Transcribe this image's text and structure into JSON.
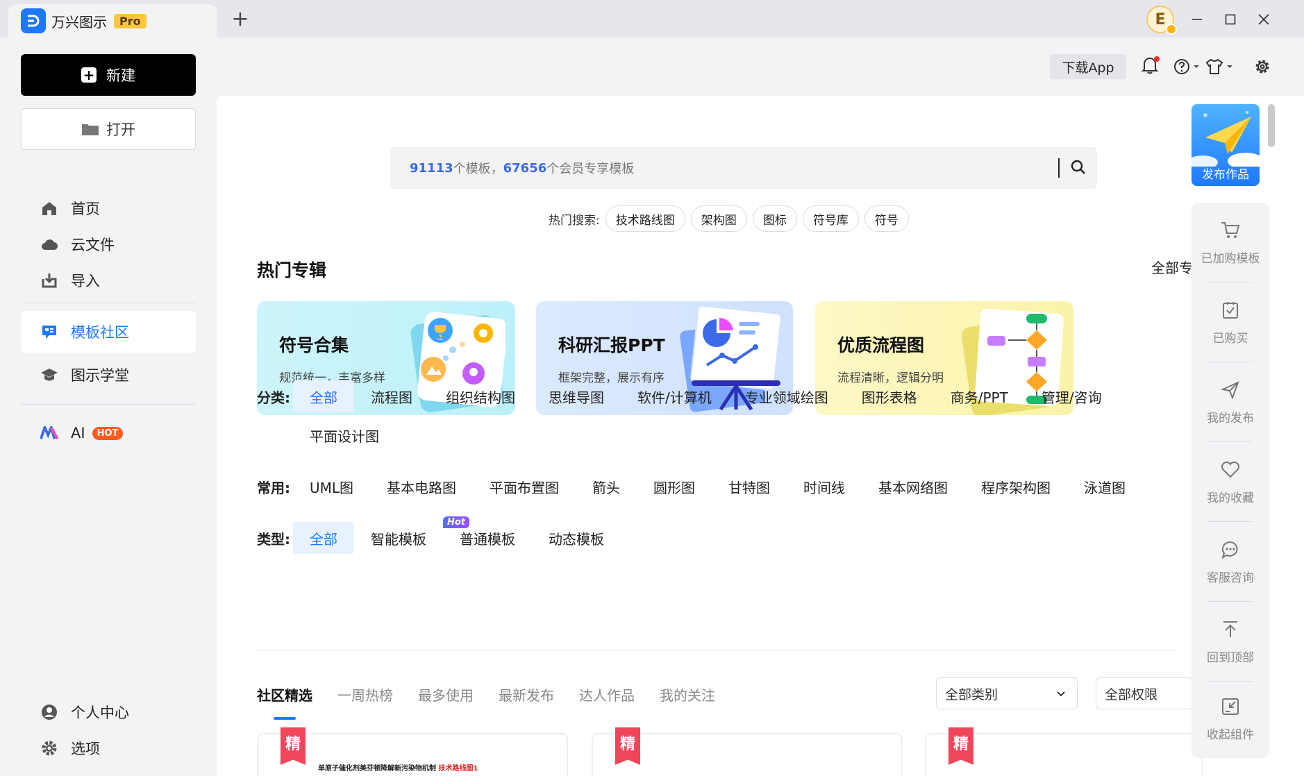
{
  "app": {
    "name": "万兴图示",
    "badge": "Pro",
    "avatar_letter": "E"
  },
  "sidebar": {
    "new_label": "新建",
    "open_label": "打开",
    "items": [
      {
        "label": "首页"
      },
      {
        "label": "云文件"
      },
      {
        "label": "导入"
      },
      {
        "label": "模板社区"
      },
      {
        "label": "图示学堂"
      },
      {
        "label": "AI",
        "badge": "HOT"
      },
      {
        "label": "个人中心"
      },
      {
        "label": "选项"
      }
    ]
  },
  "toolbar": {
    "download_label": "下载App"
  },
  "search": {
    "count_total": "91113",
    "text_mid": "个模板，",
    "count_member": "67656",
    "text_end": "个会员专享模板"
  },
  "hot_search": {
    "label": "热门搜索:",
    "chips": [
      "技术路线图",
      "架构图",
      "图标",
      "符号库",
      "符号"
    ]
  },
  "featured": {
    "title": "热门专辑",
    "all_label": "全部专",
    "cards": [
      {
        "title": "符号合集",
        "subtitle": "规范统一，丰富多样"
      },
      {
        "title": "科研汇报PPT",
        "subtitle": "框架完整，展示有序"
      },
      {
        "title": "优质流程图",
        "subtitle": "流程清晰，逻辑分明"
      }
    ]
  },
  "filters": {
    "category_label": "分类:",
    "categories": [
      "全部",
      "流程图",
      "组织结构图",
      "思维导图",
      "软件/计算机",
      "专业领域绘图",
      "图形表格",
      "商务/PPT",
      "管理/咨询",
      "平面设计图"
    ],
    "common_label": "常用:",
    "common": [
      "UML图",
      "基本电路图",
      "平面布置图",
      "箭头",
      "圆形图",
      "甘特图",
      "时间线",
      "基本网络图",
      "程序架构图",
      "泳道图"
    ],
    "type_label": "类型:",
    "types": [
      "全部",
      "智能模板",
      "普通模板",
      "动态模板"
    ],
    "type_hot": "Hot"
  },
  "tabs": [
    "社区精选",
    "一周热榜",
    "最多使用",
    "最新发布",
    "达人作品",
    "我的关注"
  ],
  "dropdowns": {
    "category": "全部类别",
    "permission": "全部权限"
  },
  "templates": [
    {
      "badge": "精",
      "line_a": "单原子催化剂美芬顿降解新污染物机制 ",
      "line_b": "技术路线图1"
    },
    {
      "badge": "精"
    },
    {
      "badge": "精"
    }
  ],
  "rail": {
    "publish_label": "发布作品",
    "items": [
      {
        "label": "已加购模板",
        "icon": "cart-icon"
      },
      {
        "label": "已购买",
        "icon": "purchased-icon"
      },
      {
        "label": "我的发布",
        "icon": "send-icon"
      },
      {
        "label": "我的收藏",
        "icon": "heart-icon"
      },
      {
        "label": "客服咨询",
        "icon": "chat-icon"
      },
      {
        "label": "回到顶部",
        "icon": "to-top-icon"
      },
      {
        "label": "收起组件",
        "icon": "collapse-icon"
      }
    ]
  },
  "colors": {
    "accent": "#1e78ff",
    "hot": "#ff5a1f",
    "jing": "#f0455a"
  }
}
